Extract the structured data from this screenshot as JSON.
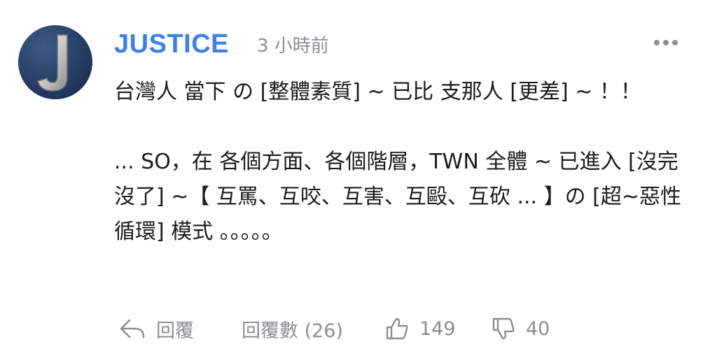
{
  "comment": {
    "author": "JUSTICE",
    "avatar_letter": "J",
    "timestamp": "3 小時前",
    "more_icon": "more-horizontal-icon",
    "body": "台灣人 當下 の [整體素質] ~ 已比 支那人 [更差] ~ ！！\n\n... SO，在 各個方面、各個階層，TWN 全體 ~ 已進入 [沒完沒了] ~【 互罵、互咬、互害、互毆、互砍 ... 】の [超~惡性循環] 模式 。。。。。"
  },
  "actions": {
    "reply_label": "回覆",
    "replies_label": "回覆數 (26)",
    "likes": "149",
    "dislikes": "40"
  },
  "colors": {
    "author": "#3d82e8",
    "meta": "#8e8e93",
    "text": "#1c1c1e",
    "avatar_bg": "#263d64"
  }
}
